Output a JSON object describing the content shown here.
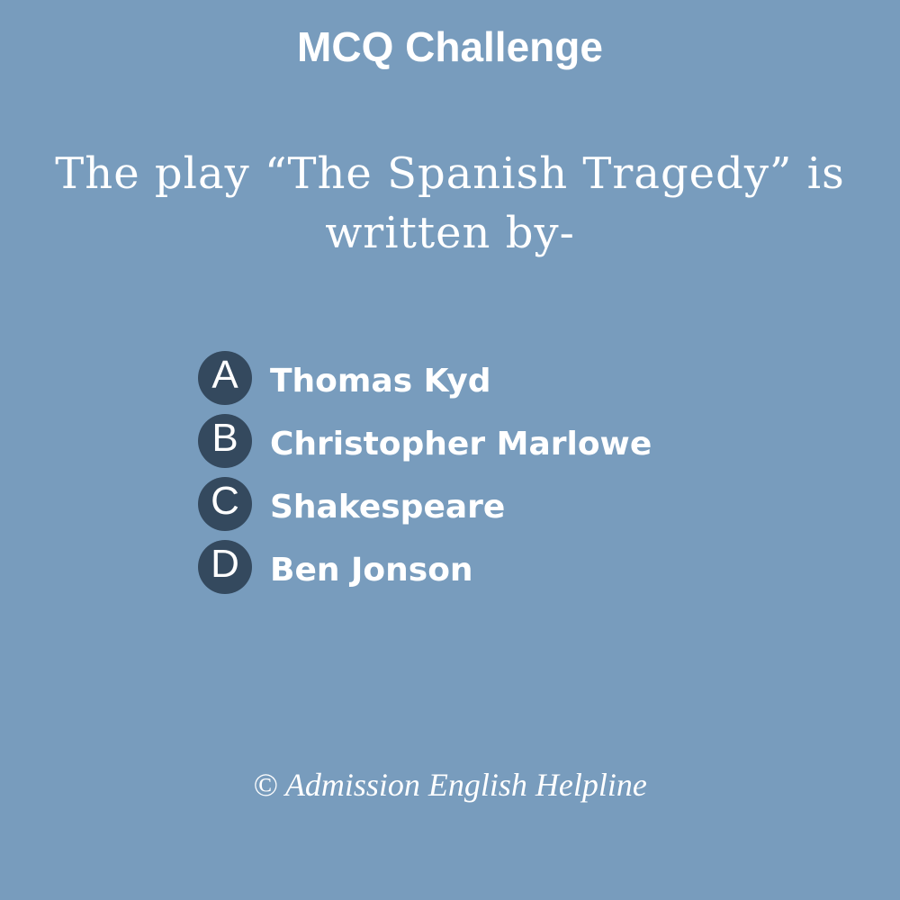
{
  "header": {
    "title": "MCQ Challenge"
  },
  "question": {
    "text": "The play “The Spanish Tragedy” is written by-"
  },
  "options": [
    {
      "letter": "A",
      "text": "Thomas Kyd"
    },
    {
      "letter": "B",
      "text": "Christopher Marlowe"
    },
    {
      "letter": "C",
      "text": "Shakespeare"
    },
    {
      "letter": "D",
      "text": "Ben Jonson"
    }
  ],
  "footer": {
    "credit": "© Admission English Helpline"
  },
  "colors": {
    "background": "#789cbd",
    "badge": "#34495e",
    "text": "#ffffff"
  }
}
